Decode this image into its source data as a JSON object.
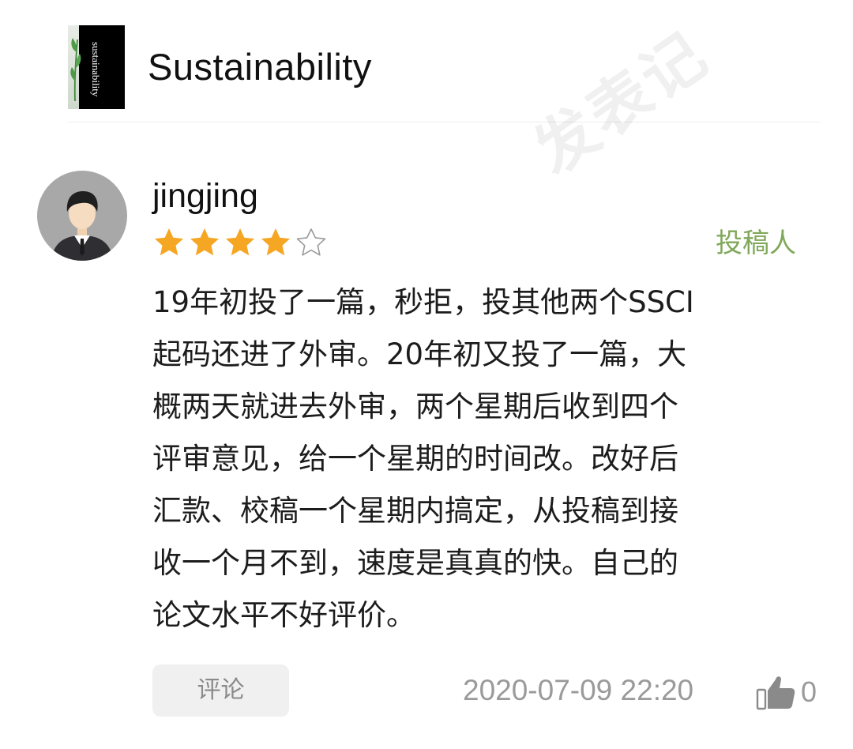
{
  "journal": {
    "name": "Sustainability",
    "logo_text": "sustainability"
  },
  "watermark": "发表记",
  "review": {
    "username": "jingjing",
    "rating": 4,
    "rating_max": 5,
    "role": "投稿人",
    "text_lines": [
      "19年初投了一篇，秒拒，投其他两个SSCI",
      "起码还进了外审。20年初又投了一篇，大",
      "概两天就进去外审，两个星期后收到四个",
      "评审意见，给一个星期的时间改。改好后",
      "汇款、校稿一个星期内搞定，从投稿到接",
      "收一个月不到，速度是真真的快。自己的",
      "论文水平不好评价。"
    ],
    "comment_label": "评论",
    "date": "2020-07-09 22:20",
    "likes": "0"
  },
  "colors": {
    "star_filled": "#f5a623",
    "role": "#7fa85a",
    "meta_text": "#9a9a9a",
    "avatar_bg": "#a8a8a8"
  },
  "icons": {
    "star": "star-icon",
    "star_empty": "star-outline-icon",
    "like": "thumbs-up-icon",
    "avatar": "user-avatar-icon"
  }
}
